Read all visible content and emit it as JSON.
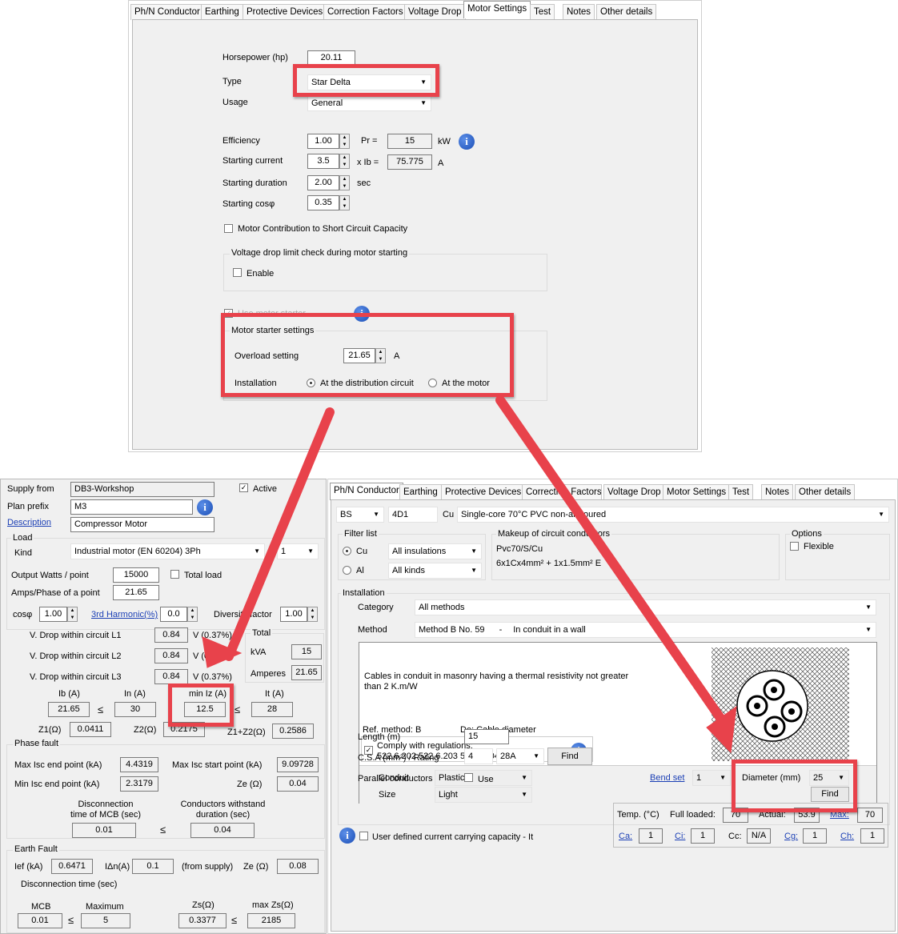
{
  "top": {
    "tabs": [
      "Ph/N Conductor",
      "Earthing",
      "Protective Devices",
      "Correction Factors",
      "Voltage Drop",
      "Motor Settings",
      "Test",
      "Notes",
      "Other details"
    ],
    "horsepower_label": "Horsepower (hp)",
    "horsepower": "20.11",
    "type_label": "Type",
    "type": "Star Delta",
    "usage_label": "Usage",
    "usage": "General",
    "efficiency_label": "Efficiency",
    "efficiency": "1.00",
    "pr_label": "Pr =",
    "pr": "15",
    "pr_unit": "kW",
    "start_current_label": "Starting current",
    "start_current": "3.5",
    "xib_label": "x Ib =",
    "xib": "75.775",
    "xib_unit": "A",
    "start_duration_label": "Starting duration",
    "start_duration": "2.00",
    "sec": "sec",
    "start_cos_label": "Starting cosφ",
    "start_cos": "0.35",
    "motor_contrib": "Motor Contribution to Short Circuit Capacity",
    "vdrop_group": "Voltage drop limit check during motor starting",
    "enable": "Enable",
    "use_starter": "Use motor starter",
    "starter_group": "Motor starter settings",
    "overload_label": "Overload setting",
    "overload": "21.65",
    "overload_unit": "A",
    "installation_label": "Installation",
    "inst_dist": "At the distribution circuit",
    "inst_motor": "At the motor"
  },
  "left": {
    "supply_from_label": "Supply from",
    "supply_from": "DB3-Workshop",
    "active": "Active",
    "plan_prefix_label": "Plan prefix",
    "plan_prefix": "M3",
    "description_label": "Description",
    "description": "Compressor Motor",
    "load_group": "Load",
    "kind_label": "Kind",
    "kind": "Industrial motor (EN 60204) 3Ph",
    "kind_count": "1",
    "output_watts_label": "Output Watts / point",
    "output_watts": "15000",
    "total_load": "Total load",
    "amps_label": "Amps/Phase of a point",
    "amps": "21.65",
    "cos_label": "cosφ",
    "cos": "1.00",
    "harmonic_label": "3rd Harmonic(%)",
    "harmonic": "0.0",
    "diversity_label": "Diversity factor",
    "diversity": "1.00",
    "vd1_label": "V. Drop within circuit L1",
    "vd1": "0.84",
    "vd1_pct": "V (0.37%)",
    "vd2_label": "V. Drop within circuit L2",
    "vd2": "0.84",
    "vd2_pct": "V (0.37%)",
    "vd3_label": "V. Drop within circuit L3",
    "vd3": "0.84",
    "vd3_pct": "V (0.37%)",
    "total_group": "Total",
    "kva_label": "kVA",
    "kva": "15",
    "amperes_label": "Amperes",
    "amperes": "21.65",
    "ib_label": "Ib (A)",
    "ib": "21.65",
    "in_label": "In (A)",
    "in": "30",
    "miniz_label": "min Iz (A)",
    "miniz": "12.5",
    "it_label": "It (A)",
    "it": "28",
    "le": "≤",
    "z1_label": "Z1(Ω)",
    "z1": "0.0411",
    "z2_label": "Z2(Ω)",
    "z2": "0.2175",
    "z12_label": "Z1+Z2(Ω)",
    "z12": "0.2586",
    "phase_fault": "Phase fault",
    "max_isc_end_label": "Max Isc end point (kA)",
    "max_isc_end": "4.4319",
    "max_isc_start_label": "Max Isc start point (kA)",
    "max_isc_start": "9.09728",
    "min_isc_end_label": "Min Isc end point (kA)",
    "min_isc_end": "2.3179",
    "ze_label": "Ze (Ω)",
    "ze": "0.04",
    "disc_label": "Disconnection time of MCB (sec)",
    "disc": "0.01",
    "withstand_label": "Conductors withstand duration (sec)",
    "withstand": "0.04",
    "earth_fault": "Earth Fault",
    "ief_label": "Ief (kA)",
    "ief": "0.6471",
    "idn_label": "IΔn(A)",
    "idn": "0.1",
    "from_supply": "(from supply)",
    "ze2_label": "Ze (Ω)",
    "ze2": "0.08",
    "disc_time_label": "Disconnection time (sec)",
    "mcb_label": "MCB",
    "mcb": "0.01",
    "maximum_label": "Maximum",
    "maximum": "5",
    "zs_label": "Zs(Ω)",
    "zs": "0.3377",
    "maxzs_label": "max Zs(Ω)",
    "maxzs": "2185"
  },
  "right": {
    "tabs": [
      "Ph/N Conductor",
      "Earthing",
      "Protective Devices",
      "Correction Factors",
      "Voltage Drop",
      "Motor Settings",
      "Test",
      "Notes",
      "Other details"
    ],
    "standard": "BS",
    "code": "4D1",
    "material": "Cu",
    "cable": "Single-core 70°C PVC non-armoured",
    "filter_group": "Filter list",
    "cu": "Cu",
    "al": "Al",
    "insulations": "All insulations",
    "kinds": "All kinds",
    "makeup_group": "Makeup of circuit conductors",
    "makeup1": "Pvc70/S/Cu",
    "makeup2": "6x1Cx4mm² + 1x1.5mm² E",
    "options_group": "Options",
    "flexible": "Flexible",
    "installation_group": "Installation",
    "category_label": "Category",
    "category": "All methods",
    "method_label": "Method",
    "method": "Method B No. 59",
    "method_sep": "-",
    "method_desc": "In conduit in a wall",
    "desc": "Cables in conduit in masonry having a thermal resistivity not greater than 2 K.m/W",
    "ref_method": "Ref. method: B",
    "de": "De: Cable diameter",
    "comply": "Comply with regulations:",
    "regs": "522.6.202 522.6.203 522.6.204",
    "conduit_label": "Conduit",
    "conduit": "Plastic",
    "size_label": "Size",
    "size": "Light",
    "bend_set": "Bend set",
    "bend": "1",
    "diameter_label": "Diameter (mm)",
    "diameter": "25",
    "find": "Find",
    "length_label": "Length (m)",
    "length": "15",
    "csa_label": "C.S.A (mm²) / Rating",
    "csa": "4",
    "rating": "28A",
    "find2": "Find",
    "parallel_label": "Parallel conductors",
    "use": "Use",
    "temp_label": "Temp. (°C)",
    "full_loaded_label": "Full loaded:",
    "full_loaded": "70",
    "actual_label": "Actual:",
    "actual": "53.9",
    "max_label": "Max:",
    "max": "70",
    "ca_label": "Ca:",
    "ca": "1",
    "ci_label": "Ci:",
    "ci": "1",
    "cc_label": "Cc:",
    "cc": "N/A",
    "cg_label": "Cg:",
    "cg": "1",
    "ch_label": "Ch:",
    "ch": "1",
    "user_defined": "User defined current carrying capacity - It"
  },
  "colors": {
    "highlight": "#e8424b",
    "info": "#1c4fb6",
    "link": "#1b3fb5"
  }
}
